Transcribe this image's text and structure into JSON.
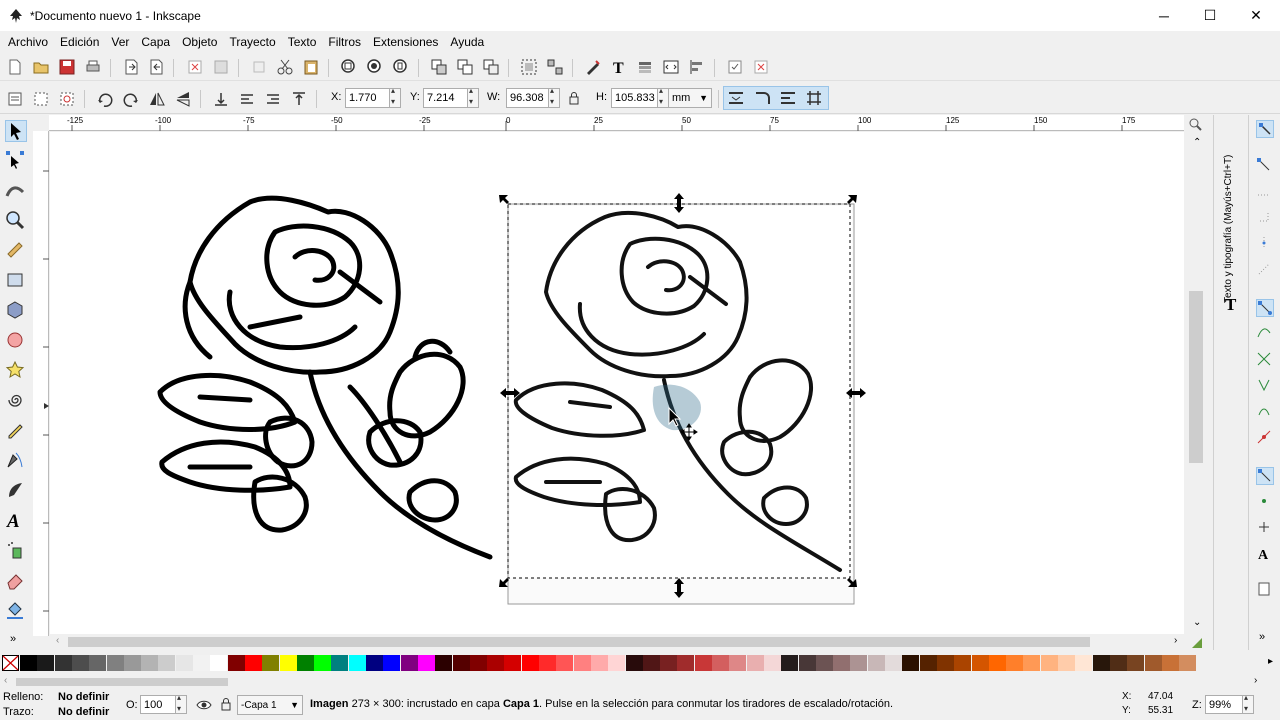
{
  "window": {
    "title": "*Documento nuevo 1 - Inkscape",
    "minimize": "─",
    "maximize": "☐",
    "close": "✕"
  },
  "menu": [
    "Archivo",
    "Edición",
    "Ver",
    "Capa",
    "Objeto",
    "Trayecto",
    "Texto",
    "Filtros",
    "Extensiones",
    "Ayuda"
  ],
  "controls": {
    "x_label": "X:",
    "x_value": "1.770",
    "y_label": "Y:",
    "y_value": "7.214",
    "w_label": "W:",
    "w_value": "96.308",
    "h_label": "H:",
    "h_value": "105.833",
    "unit": "mm"
  },
  "ruler": {
    "h_ticks": [
      "-125",
      "-100",
      "-75",
      "-50",
      "-25",
      "0",
      "25",
      "50",
      "75",
      "100",
      "125",
      "150",
      "175"
    ]
  },
  "dock": {
    "panel_title": "Texto y tipografía (Mayús+Ctrl+T)",
    "panel_icon": "T"
  },
  "status": {
    "fill_label": "Relleno:",
    "fill_value": "No definir",
    "stroke_label": "Trazo:",
    "stroke_value": "No definir",
    "opacity_label": "O:",
    "opacity_value": "100",
    "layer": "-Capa 1",
    "message_bold": "Imagen",
    "message_1": " 273 × 300: incrustado en capa ",
    "message_layer": "Capa 1",
    "message_2": ". Pulse en la selección para conmutar los tiradores de escalado/rotación.",
    "x_label": "X:",
    "x_value": "47.04",
    "y_label": "Y:",
    "y_value": "55.31",
    "zoom_label": "Z:",
    "zoom_value": "99%"
  },
  "palette": [
    "#000000",
    "#1a1a1a",
    "#333333",
    "#4d4d4d",
    "#666666",
    "#808080",
    "#999999",
    "#b3b3b3",
    "#cccccc",
    "#e6e6e6",
    "#f2f2f2",
    "#ffffff",
    "#800000",
    "#ff0000",
    "#808000",
    "#ffff00",
    "#008000",
    "#00ff00",
    "#008080",
    "#00ffff",
    "#000080",
    "#0000ff",
    "#800080",
    "#ff00ff",
    "#2b0000",
    "#550000",
    "#800000",
    "#aa0000",
    "#d40000",
    "#ff0000",
    "#ff2a2a",
    "#ff5555",
    "#ff8080",
    "#ffaaaa",
    "#ffd5d5",
    "#280b0b",
    "#501616",
    "#782121",
    "#a02c2c",
    "#c83737",
    "#d35f5f",
    "#de8787",
    "#e9afaf",
    "#f4d7d7",
    "#241c1c",
    "#483737",
    "#6c5353",
    "#916f6f",
    "#ac9393",
    "#c8b7b7",
    "#e3dbdb",
    "#2b1100",
    "#552200",
    "#803300",
    "#aa4400",
    "#d45500",
    "#ff6600",
    "#ff7f2a",
    "#ff9955",
    "#ffb380",
    "#ffccaa",
    "#ffe6d5",
    "#28170b",
    "#502d16",
    "#784421",
    "#a05a2c",
    "#c87137",
    "#d38d5f"
  ]
}
